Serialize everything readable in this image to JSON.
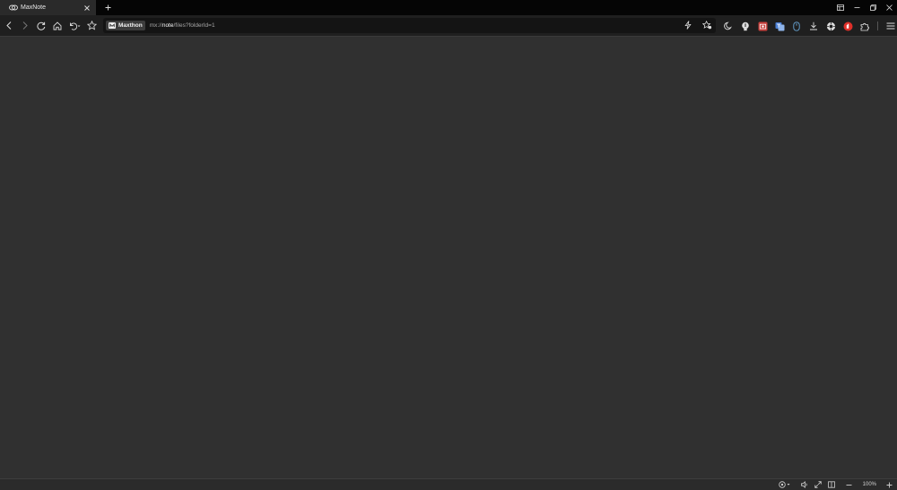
{
  "tabs": [
    {
      "title": "MaxNote",
      "favicon": "maxnote-icon",
      "active": true
    }
  ],
  "address": {
    "site_badge": "Maxthon",
    "url_scheme": "mx://",
    "url_host": "note",
    "url_path": "/files?folderId=1"
  },
  "statusbar": {
    "zoom": "100%"
  },
  "colors": {
    "content_bg": "#303030",
    "toolbar_bg": "#1f1f1f",
    "tabbar_bg": "#050505",
    "adblock_red": "#e0302a"
  }
}
